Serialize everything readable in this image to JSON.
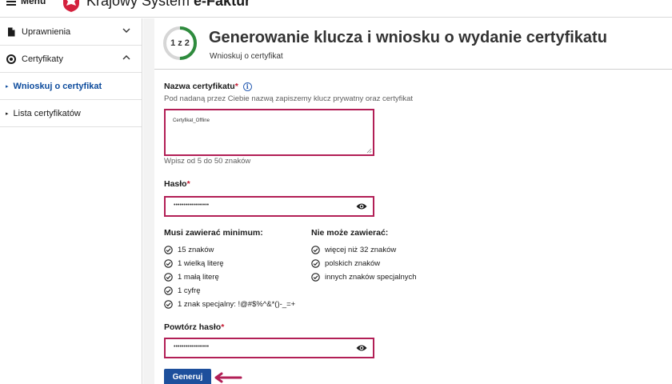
{
  "topbar": {
    "menu_label": "Menu",
    "brand_prefix": "Krajowy System ",
    "brand_bold": "e-Faktur"
  },
  "sidebar": {
    "items": [
      {
        "label": "Uprawnienia",
        "icon": "document-icon",
        "expanded": false
      },
      {
        "label": "Certyfikaty",
        "icon": "certificate-icon",
        "expanded": true
      }
    ],
    "subitems": [
      {
        "label": "Wnioskuj o certyfikat",
        "active": true
      },
      {
        "label": "Lista certyfikatów",
        "active": false
      }
    ]
  },
  "header": {
    "step": "1 z 2",
    "step_progress": 0.5,
    "title": "Generowanie klucza i wniosku o wydanie certyfikatu",
    "subtitle": "Wnioskuj o certyfikat"
  },
  "form": {
    "cert_name_label": "Nazwa certyfikatu",
    "required_mark": "*",
    "cert_name_hint": "Pod nadaną przez Ciebie nazwą zapiszemy klucz prywatny oraz certyfikat",
    "cert_name_value": "Certyfikat_Offline",
    "cert_name_constraint": "Wpisz od 5 do 50 znaków",
    "password_label": "Hasło",
    "password_value": "••••••••••••••••••",
    "must_contain_title": "Musi zawierać minimum:",
    "must_contain": [
      "15 znaków",
      "1 wielką literę",
      "1 małą literę",
      "1 cyfrę",
      "1 znak specjalny: !@#$%^&*()-_=+"
    ],
    "cannot_contain_title": "Nie może zawierać:",
    "cannot_contain": [
      "więcej niż 32 znaków",
      "polskich znaków",
      "innych znaków specjalnych"
    ],
    "repeat_password_label": "Powtórz hasło",
    "repeat_password_value": "••••••••••••••••••",
    "submit_label": "Generuj"
  },
  "colors": {
    "accent": "#1d4f9c",
    "active_nav": "#0b4a9c",
    "field_border": "#b21f56",
    "required": "#c4142d",
    "progress": "#2e8b3d",
    "arrow": "#b21f56"
  }
}
